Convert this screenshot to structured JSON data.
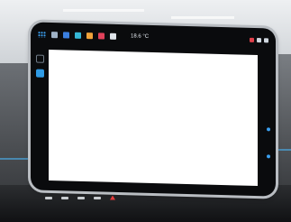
{
  "display": {
    "status_bar": {
      "temperature": "18.6 °C"
    },
    "content_redacted": true
  },
  "colors": {
    "accent": "#3ba0f0",
    "redaction": "#ffffff",
    "hazard": "#e23b3b"
  },
  "icons": {
    "status_bar": [
      "app-grid-icon",
      "car-icon",
      "media-icon",
      "phone-icon",
      "home-icon",
      "music-icon",
      "pin-icon"
    ],
    "right_status": [
      "signal-icon",
      "battery-icon",
      "notification-icon"
    ],
    "bottom": [
      "hazard-icon"
    ]
  }
}
